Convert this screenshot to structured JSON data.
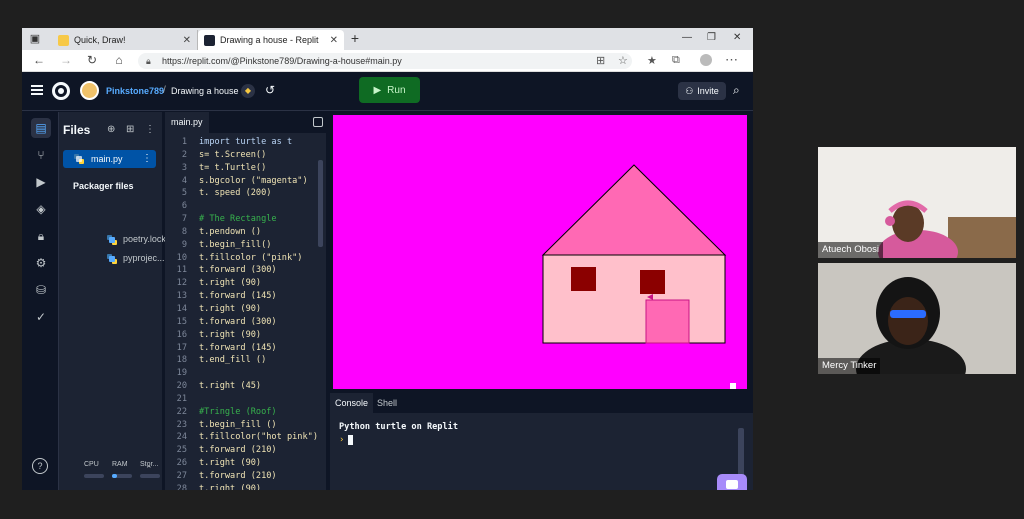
{
  "browser": {
    "tabs": [
      {
        "title": "Quick, Draw!"
      },
      {
        "title": "Drawing a house - Replit"
      }
    ],
    "url": "https://replit.com/@Pinkstone789/Drawing-a-house#main.py"
  },
  "header": {
    "username": "Pinkstone789",
    "separator": "/",
    "repl_name": "Drawing a house",
    "run_label": "Run",
    "invite_label": "Invite"
  },
  "files": {
    "title": "Files",
    "main_file": "main.py",
    "packager_title": "Packager files",
    "packager_items": [
      "poetry.lock",
      "pyprojec..."
    ]
  },
  "resources": {
    "cpu": "CPU",
    "ram": "RAM",
    "storage": "Stor..."
  },
  "editor": {
    "tab": "main.py",
    "lines": [
      {
        "n": "1",
        "t": "import turtle as t",
        "k": "kw"
      },
      {
        "n": "2",
        "t": "s= t.Screen()",
        "k": ""
      },
      {
        "n": "3",
        "t": "t= t.Turtle()",
        "k": ""
      },
      {
        "n": "4",
        "t": "s.bgcolor (\"magenta\")",
        "k": ""
      },
      {
        "n": "5",
        "t": "t. speed (200)",
        "k": ""
      },
      {
        "n": "6",
        "t": "",
        "k": ""
      },
      {
        "n": "7",
        "t": "# The Rectangle",
        "k": "cmt"
      },
      {
        "n": "8",
        "t": "t.pendown ()",
        "k": ""
      },
      {
        "n": "9",
        "t": "t.begin_fill()",
        "k": ""
      },
      {
        "n": "10",
        "t": "t.fillcolor (\"pink\")",
        "k": ""
      },
      {
        "n": "11",
        "t": "t.forward (300)",
        "k": ""
      },
      {
        "n": "12",
        "t": "t.right (90)",
        "k": ""
      },
      {
        "n": "13",
        "t": "t.forward (145)",
        "k": ""
      },
      {
        "n": "14",
        "t": "t.right (90)",
        "k": ""
      },
      {
        "n": "15",
        "t": "t.forward (300)",
        "k": ""
      },
      {
        "n": "16",
        "t": "t.right (90)",
        "k": ""
      },
      {
        "n": "17",
        "t": "t.forward (145)",
        "k": ""
      },
      {
        "n": "18",
        "t": "t.end_fill ()",
        "k": ""
      },
      {
        "n": "19",
        "t": "",
        "k": ""
      },
      {
        "n": "20",
        "t": "t.right (45)",
        "k": ""
      },
      {
        "n": "21",
        "t": "",
        "k": ""
      },
      {
        "n": "22",
        "t": "#Tringle (Roof)",
        "k": "cmt"
      },
      {
        "n": "23",
        "t": "t.begin_fill ()",
        "k": ""
      },
      {
        "n": "24",
        "t": "t.fillcolor(\"hot pink\")",
        "k": ""
      },
      {
        "n": "25",
        "t": "t.forward (210)",
        "k": ""
      },
      {
        "n": "26",
        "t": "t.right (90)",
        "k": ""
      },
      {
        "n": "27",
        "t": "t.forward (210)",
        "k": ""
      },
      {
        "n": "28",
        "t": "t.right (90)",
        "k": ""
      }
    ]
  },
  "console": {
    "tab_console": "Console",
    "tab_shell": "Shell",
    "output": "Python turtle on Replit",
    "prompt": "›"
  },
  "participants": [
    {
      "name": "Atuech Obosi"
    },
    {
      "name": "Mercy Tinker"
    }
  ],
  "colors": {
    "canvas_bg": "#ff00ff",
    "wall": "#ffc0cb",
    "roof": "#ff69b4",
    "window": "#8b0000",
    "door": "#ff69b4",
    "run_button": "#0f6b23"
  },
  "icons": {
    "menu": "hamburger-icon",
    "logo": "replit-logo",
    "search": "search-icon",
    "history": "history-icon",
    "invite": "add-user-icon"
  }
}
